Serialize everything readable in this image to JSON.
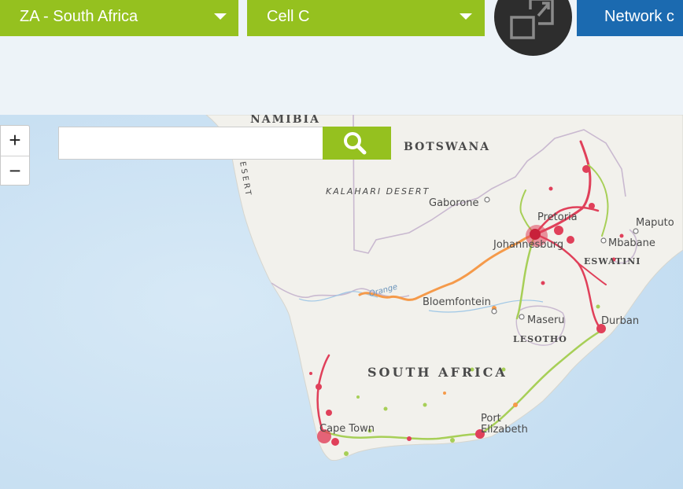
{
  "controls": {
    "country_select": "ZA - South Africa",
    "network_select": "Cell C",
    "network_button": "Network c"
  },
  "map": {
    "zoom_in": "+",
    "zoom_out": "−",
    "search_placeholder": "",
    "labels": {
      "namibia": "NAMIBIA",
      "botswana": "BOTSWANA",
      "kalahari": "KALAHARI DESERT",
      "desert": "ESERT",
      "gaborone": "Gaborone",
      "pretoria": "Pretoria",
      "johannesburg": "Johannesburg",
      "maputo": "Maputo",
      "mbabane": "Mbabane",
      "eswatini": "ESWATINI",
      "orange": "Orange",
      "bloemfontein": "Bloemfontein",
      "maseru": "Maseru",
      "lesotho": "LESOTHO",
      "durban": "Durban",
      "south_africa": "SOUTH AFRICA",
      "cape_town": "Cape Town",
      "port": "Port",
      "elizabeth": "Elizabeth"
    }
  },
  "colors": {
    "brand_green": "#95c11f",
    "brand_blue": "#1b6ab0",
    "coverage_red": "#e0405a",
    "coverage_orange": "#f59a4a",
    "coverage_green": "#a7cf57",
    "ocean": "#cfe4f3",
    "land": "#f2f1ec"
  },
  "icons": {
    "expand": "expand-icon",
    "search": "search-icon",
    "dropdown": "caret-down-icon"
  }
}
